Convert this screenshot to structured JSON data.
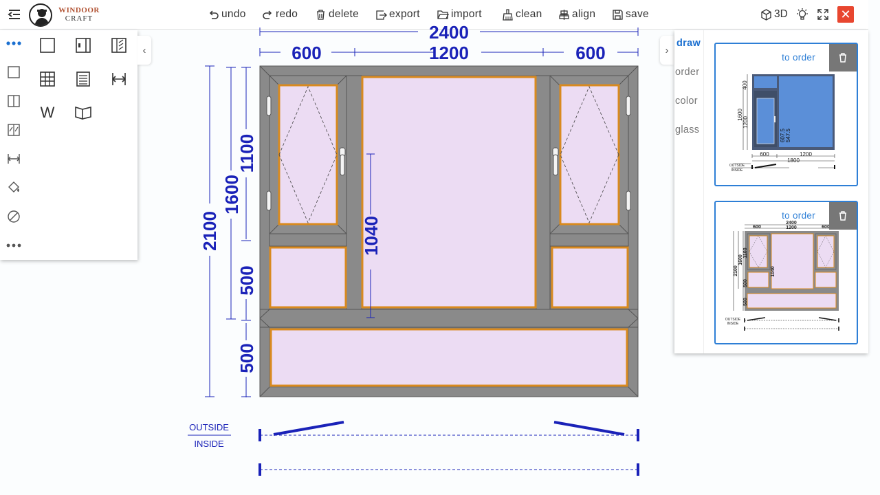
{
  "brand": {
    "line1": "WINDOOR",
    "line2": "CRAFT"
  },
  "toolbar": {
    "undo": "undo",
    "redo": "redo",
    "delete": "delete",
    "export": "export",
    "import": "import",
    "clean": "clean",
    "align": "align",
    "save": "save",
    "view3d": "3D"
  },
  "left_panel": {
    "side_icons": [
      "more-dots-icon",
      "square-frame-icon",
      "two-pane-icon",
      "sash-split-icon",
      "dimension-icon",
      "paint-bucket-icon",
      "circle-slash-icon",
      "more-dots-icon"
    ],
    "grid_icons": [
      "fixed-frame-icon",
      "side-sash-icon",
      "casement-icon",
      "grid-mullion-icon",
      "blind-icon",
      "width-dimension-icon",
      "text-w-icon",
      "book-open-icon"
    ],
    "grid_text_w": "W"
  },
  "right_panel": {
    "tabs": [
      "draw",
      "order",
      "color",
      "glass"
    ],
    "active_tab": "draw",
    "cards": [
      {
        "order_label": "to order",
        "dims": {
          "d400": "400",
          "d1600": "1600",
          "d1200": "1200",
          "d607": "607.5",
          "d547": "547.5",
          "w600": "600",
          "w1200": "1200",
          "w1800": "1800"
        },
        "outside": "OUTSIDE",
        "inside": "INSIDE"
      },
      {
        "order_label": "to order",
        "dims": {
          "top2400": "2400",
          "top600": "600",
          "top1200": "1200",
          "top600b": "600",
          "h1100": "1100",
          "h1600": "1600",
          "h2100": "2100",
          "h500": "500",
          "h500b": "500",
          "h1040": "1040"
        },
        "outside": "OUTSIDE",
        "inside": "INSIDE"
      }
    ]
  },
  "drawing": {
    "overall_width": "2400",
    "widths": [
      "600",
      "1200",
      "600"
    ],
    "overall_height": "2100",
    "height_upper": "1600",
    "height_sash": "1100",
    "height_transom": "500",
    "height_bottom": "500",
    "center_height": "1040",
    "outside_label": "OUTSIDE",
    "inside_label": "INSIDE"
  },
  "colors": {
    "dimension_blue": "#1a22b8",
    "frame_gray": "#8a8a8a",
    "glass_pink": "#ecdcf3",
    "gasket_orange": "#d98a1f",
    "accent_blue": "#2e7fd6",
    "close_red": "#e8462f"
  }
}
